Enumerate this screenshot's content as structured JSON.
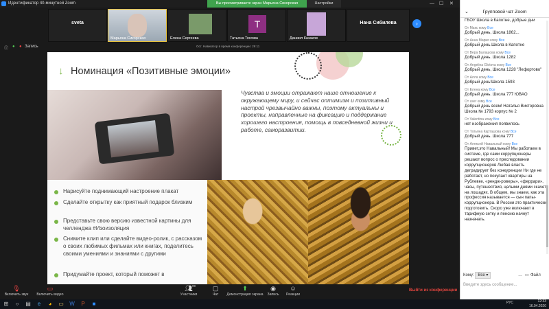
{
  "window": {
    "title": "Идентификатор 40-минутной Zoom",
    "share_banner": "Вы просматриваете экран Марьяна Сикорская",
    "view_options": "Настройки просмотра ▾"
  },
  "participants": [
    {
      "name": "sveta",
      "mode": "text"
    },
    {
      "name": "Марьяна Сикорская",
      "mode": "video",
      "color": "#d9c4b8"
    },
    {
      "name": "Елена Сергеева",
      "mode": "video",
      "color": "#7a9a6a"
    },
    {
      "name": "Татьяна Тюхова",
      "mode": "letter",
      "letter": "T",
      "color": "#8e2f82"
    },
    {
      "name": "Даниил Казаков",
      "mode": "video",
      "color": "#c7a6d8"
    },
    {
      "name": "Нана Сибилева",
      "mode": "text"
    }
  ],
  "topbar": {
    "record_label": "Запись",
    "meeting_time": "Ост. Навигатор в время конференции: 29:11"
  },
  "slide": {
    "title": "Номинация «Позитивные эмоции»",
    "quote": "Чувства и эмоции отражают наше отношение к окружающему миру, и сейчас оптимизм и позитивный настрой чрезвычайно важны, поэтому актуальны и проекты, направленные на фиксацию и поддержание хорошего настроения, помощь в повседневной жизни и работе, саморазвитии.",
    "bullets": [
      "Нарисуйте поднимающий настроение плакат",
      "Сделайте открытку как приятный подарок близким",
      "Представьте свою версию известной картины для челленджа #Изоизоляция",
      "Снимите клип или сделайте видео-ролик, с рассказом о своих любимых фильмах или книгах, поделитесь своими умениями и знаниями с другими",
      "Придумайте проект, который поможет в"
    ]
  },
  "chat": {
    "header": "Групповой чат Zoom",
    "first_line": "ГБОУ Школа в Капотне, добрые дни",
    "messages": [
      {
        "from": "Макс",
        "to": "Все",
        "text": "Добрый день, Школа 1862..."
      },
      {
        "from": "Анна Мария",
        "to": "Все",
        "text": "Добрый день.Школа в Капотне"
      },
      {
        "from": "Вера Балашова",
        "to": "Все",
        "text": "Добрый день. Школа 1282"
      },
      {
        "from": "Angelina Glotova",
        "to": "Все",
        "text": "Добрый день, Школа 1228 \"Лефортово\""
      },
      {
        "from": "Алла",
        "to": "Все",
        "text": "Добрый день!Школа 1593"
      },
      {
        "from": "Елена",
        "to": "Все",
        "text": "Добрый день. Школа 777 ЮВАО"
      },
      {
        "from": "user",
        "to": "Все",
        "text": "Добрый день всем! Наталья Викторовна Школа № 1793 корпус № 2"
      },
      {
        "from": "Valentina",
        "to": "Все",
        "text": "нет изображения появилось"
      },
      {
        "from": "Татьяна Карташова",
        "to": "Все",
        "text": "Добрый день. Школа 777"
      },
      {
        "from": "Алексей Навальный",
        "to": "Все",
        "text": "Привет,это Навальный! Мы работаем в системе, где сами коррупционеры решают вопрос о преследовании коррупционеров Любая власть деградирует без конкуренции Ни где не работает, но покупает квартиры на Рублевке, «рендж-роверы», «феррари», часы, путешествия, целыми днями скачет на лошадях. В общем, мы знаем, как эта профессия называется — сын папы-коррупционера. В России это практически подготовить. Скоро уже включают в тарифную сетку и пенсию начнут назначать."
      }
    ],
    "to_label": "Кому:",
    "to_value": "Все ▾",
    "file_label": "Файл",
    "input_placeholder": "Введите здесь сообщение..."
  },
  "bottom": {
    "audio": "Включить звук",
    "video": "Включить видео",
    "participants": "Участники",
    "participants_count": "99",
    "chat": "Чат",
    "share": "Демонстрация экрана",
    "record": "Запись",
    "reactions": "Реакции",
    "leave": "Выйти из конференции"
  },
  "taskbar": {
    "lang": "РУС",
    "time": "12:33",
    "date": "16.04.2020"
  }
}
